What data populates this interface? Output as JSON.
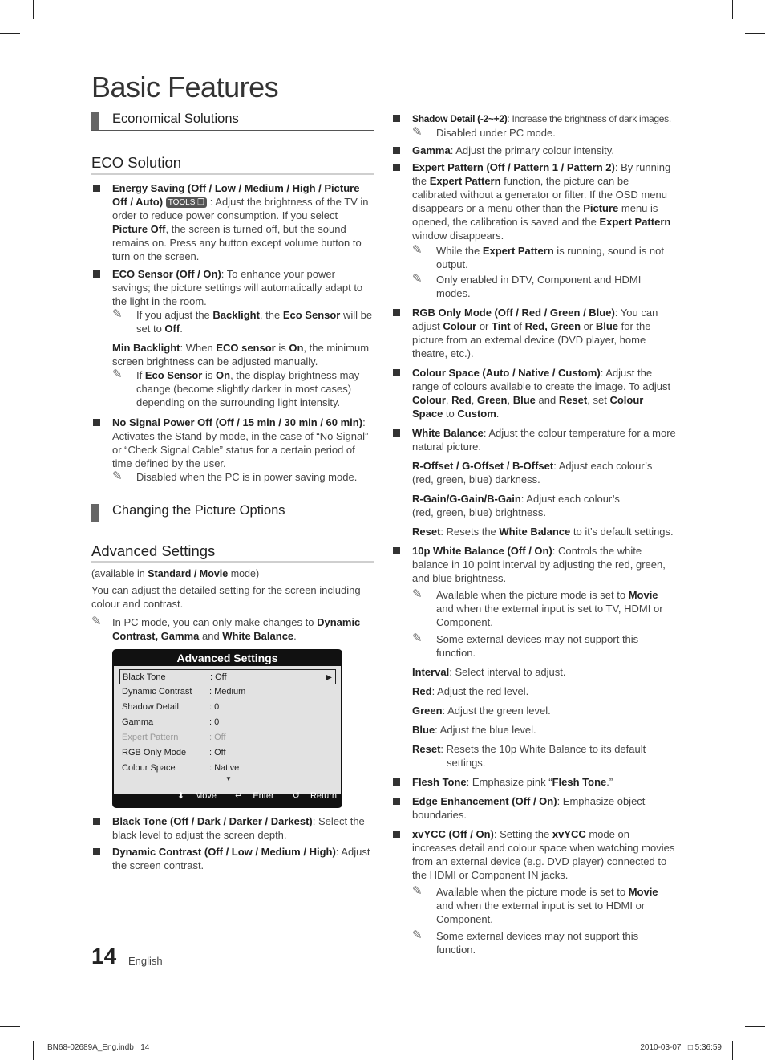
{
  "page_title": "Basic Features",
  "left": {
    "section1": "Economical Solutions",
    "eco_heading": "ECO Solution",
    "energy_saving": {
      "bold": "Energy Saving (Off / Low / Medium / High / Picture Off / Auto)",
      "tools_badge": "TOOLS",
      "text1": " : Adjust the brightness of the TV in order to reduce power consumption. If you select ",
      "bold2": "Picture Off",
      "text2": ", the screen is turned off, but the sound remains on. Press any button except volume button to turn on the screen."
    },
    "eco_sensor": {
      "bold": "ECO Sensor (Off / On)",
      "text": ": To enhance your power savings; the picture settings will automatically adapt to the light in the room.",
      "note": {
        "t1": "If you adjust the ",
        "b1": "Backlight",
        "t2": ", the ",
        "b2": "Eco Sensor",
        "t3": " will be set to ",
        "b3": "Off",
        "t4": "."
      }
    },
    "min_backlight": {
      "b1": "Min Backlight",
      "t1": ": When ",
      "b2": "ECO sensor",
      "t2": " is ",
      "b3": "On",
      "t3": ", the minimum screen brightness can be adjusted manually.",
      "note": {
        "t1": "If ",
        "b1": "Eco Sensor",
        "t2": " is ",
        "b2": "On",
        "t3": ", the display brightness may change (become slightly darker in most cases) depending on the surrounding light intensity."
      }
    },
    "no_signal": {
      "bold": "No Signal Power Off (Off / 15 min / 30 min / 60 min)",
      "text": ": Activates the Stand-by mode, in the case of “No Signal” or “Check Signal Cable” status for a certain period of time defined by the user.",
      "note": "Disabled when the PC is in power saving mode."
    },
    "section2": "Changing the Picture Options",
    "adv_heading": "Advanced Settings",
    "avail": {
      "t1": "(available in ",
      "b1": "Standard / Movie",
      "t2": " mode)"
    },
    "intro": "You can adjust the detailed setting for the screen including colour and contrast.",
    "pc_note": {
      "t1": "In PC mode, you can only make changes to ",
      "b1": "Dynamic Contrast, Gamma",
      "t2": " and ",
      "b2": "White Balance",
      "t3": "."
    },
    "black_tone": {
      "bold": "Black Tone (Off / Dark / Darker / Darkest)",
      "text": ": Select the black level to adjust the screen depth."
    },
    "dynamic_contrast": {
      "bold": "Dynamic Contrast (Off / Low / Medium / High)",
      "text": ": Adjust the screen contrast."
    }
  },
  "osd": {
    "title": "Advanced Settings",
    "rows": [
      {
        "key": "Black Tone",
        "value": ": Off"
      },
      {
        "key": "Dynamic Contrast",
        "value": ": Medium"
      },
      {
        "key": "Shadow Detail",
        "value": ": 0"
      },
      {
        "key": "Gamma",
        "value": ": 0"
      },
      {
        "key": "Expert Pattern",
        "value": ": Off"
      },
      {
        "key": "RGB Only Mode",
        "value": ": Off"
      },
      {
        "key": "Colour Space",
        "value": ": Native"
      }
    ],
    "footer": {
      "move": "Move",
      "enter": "Enter",
      "return": "Return"
    }
  },
  "right": {
    "shadow": {
      "bold": "Shadow Detail (-2~+2)",
      "text": ": Increase the brightness of dark images.",
      "note": "Disabled under PC mode."
    },
    "gamma": {
      "bold": "Gamma",
      "text": ": Adjust the primary colour intensity."
    },
    "expert": {
      "bold": "Expert Pattern (Off / Pattern 1 / Pattern 2)",
      "t1": ": By running the ",
      "b1": "Expert Pattern",
      "t2": " function, the picture can be calibrated without a generator or filter. If the OSD menu disappears or a menu other than the ",
      "b2": "Picture",
      "t3": " menu is opened, the calibration is saved and the ",
      "b3": "Expert Pattern",
      "t4": " window disappears.",
      "note1": {
        "t1": "While the ",
        "b1": "Expert Pattern",
        "t2": " is running, sound is not output."
      },
      "note2": "Only enabled in DTV, Component and HDMI modes."
    },
    "rgb": {
      "bold": "RGB Only Mode (Off / Red / Green / Blue)",
      "t1": ": You can adjust ",
      "b1": "Colour",
      "t2": " or ",
      "b2": "Tint",
      "t3": " of ",
      "b3": "Red, Green",
      "t4": " or ",
      "b4": "Blue",
      "t5": " for the picture from an external device (DVD player, home theatre, etc.)."
    },
    "colour_space": {
      "bold": "Colour Space (Auto / Native / Custom)",
      "t1": ": Adjust the range of colours available to create the image. To adjust ",
      "b1": "Colour",
      "s1": ", ",
      "b2": "Red",
      "s2": ", ",
      "b3": "Green",
      "s3": ", ",
      "b4": "Blue",
      "t2": " and ",
      "b5": "Reset",
      "t3": ", set ",
      "b6": "Colour Space",
      "t4": " to ",
      "b7": "Custom",
      "t5": "."
    },
    "white_balance": {
      "bold": "White Balance",
      "text": ": Adjust the colour temperature for a more natural picture.",
      "offset": {
        "bold": "R-Offset / G-Offset / B-Offset",
        "text": ": Adjust each colour’s (red, green, blue) darkness."
      },
      "gain": {
        "bold": "R-Gain/G-Gain/B-Gain",
        "text": ": Adjust each colour’s",
        "text2": "(red, green, blue) brightness."
      },
      "reset": {
        "b1": "Reset",
        "t1": ": Resets the ",
        "b2": "White Balance",
        "t2": " to it’s default settings."
      }
    },
    "wb10": {
      "bold": "10p White Balance (Off / On)",
      "text": ": Controls the white balance in 10 point interval by adjusting the red, green, and blue brightness.",
      "note1": {
        "t1": "Available when the picture mode is set to ",
        "b1": "Movie",
        "t2": " and when the external input is set to TV, HDMI or Component."
      },
      "note2": "Some external devices may not support this function.",
      "interval": {
        "bold": "Interval",
        "text": ": Select interval to adjust."
      },
      "red": {
        "bold": "Red",
        "text": ": Adjust the red level."
      },
      "green": {
        "bold": "Green",
        "text": ": Adjust the green level."
      },
      "blue": {
        "bold": "Blue",
        "text": ": Adjust the blue level."
      },
      "reset": {
        "bold": "Reset",
        "text": ": Resets the 10p White Balance to its default settings."
      }
    },
    "flesh": {
      "bold": "Flesh Tone",
      "t1": ": Emphasize pink “",
      "b1": "Flesh Tone",
      "t2": ".”"
    },
    "edge": {
      "bold": "Edge Enhancement (Off / On)",
      "text": ": Emphasize object boundaries."
    },
    "xvycc": {
      "bold": "xvYCC (Off / On)",
      "t1": ": Setting the ",
      "b1": "xvYCC",
      "t2": " mode on increases detail and colour space when watching movies from an external device (e.g. DVD player) connected to the HDMI or Component IN jacks.",
      "note1": {
        "t1": "Available when the picture mode is set to ",
        "b1": "Movie",
        "t2": " and when the external input is set to HDMI or Component."
      },
      "note2": "Some external devices may not support this function."
    }
  },
  "footer": {
    "page_number": "14",
    "language": "English",
    "file_info": "BN68-02689A_Eng.indb   14",
    "timestamp": "2010-03-07   □ 5:36:59"
  },
  "icons": {
    "note": "pencil-note-icon",
    "bullet": "square-bullet-icon"
  }
}
